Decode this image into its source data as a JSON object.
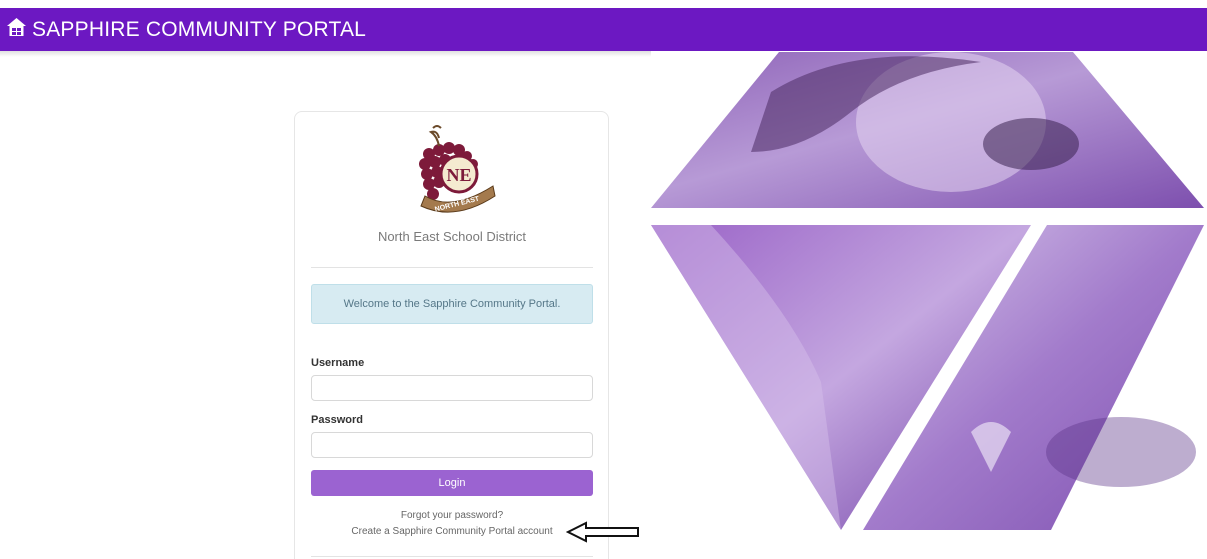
{
  "header": {
    "title": "SAPPHIRE COMMUNITY PORTAL",
    "icon": "home-icon",
    "background_color": "#6c18c2"
  },
  "login": {
    "district_name": "North East School District",
    "logo_text": "NORTH EAST",
    "logo_monogram": "NE",
    "welcome_message": "Welcome to the Sapphire Community Portal.",
    "username_label": "Username",
    "username_value": "",
    "password_label": "Password",
    "password_value": "",
    "login_button_label": "Login",
    "forgot_password_link": "Forgot your password?",
    "create_account_link": "Create a Sapphire Community Portal account",
    "button_color": "#9b63d1",
    "welcome_background": "#d7ebf2"
  },
  "annotation": {
    "icon": "arrow-left-icon"
  }
}
